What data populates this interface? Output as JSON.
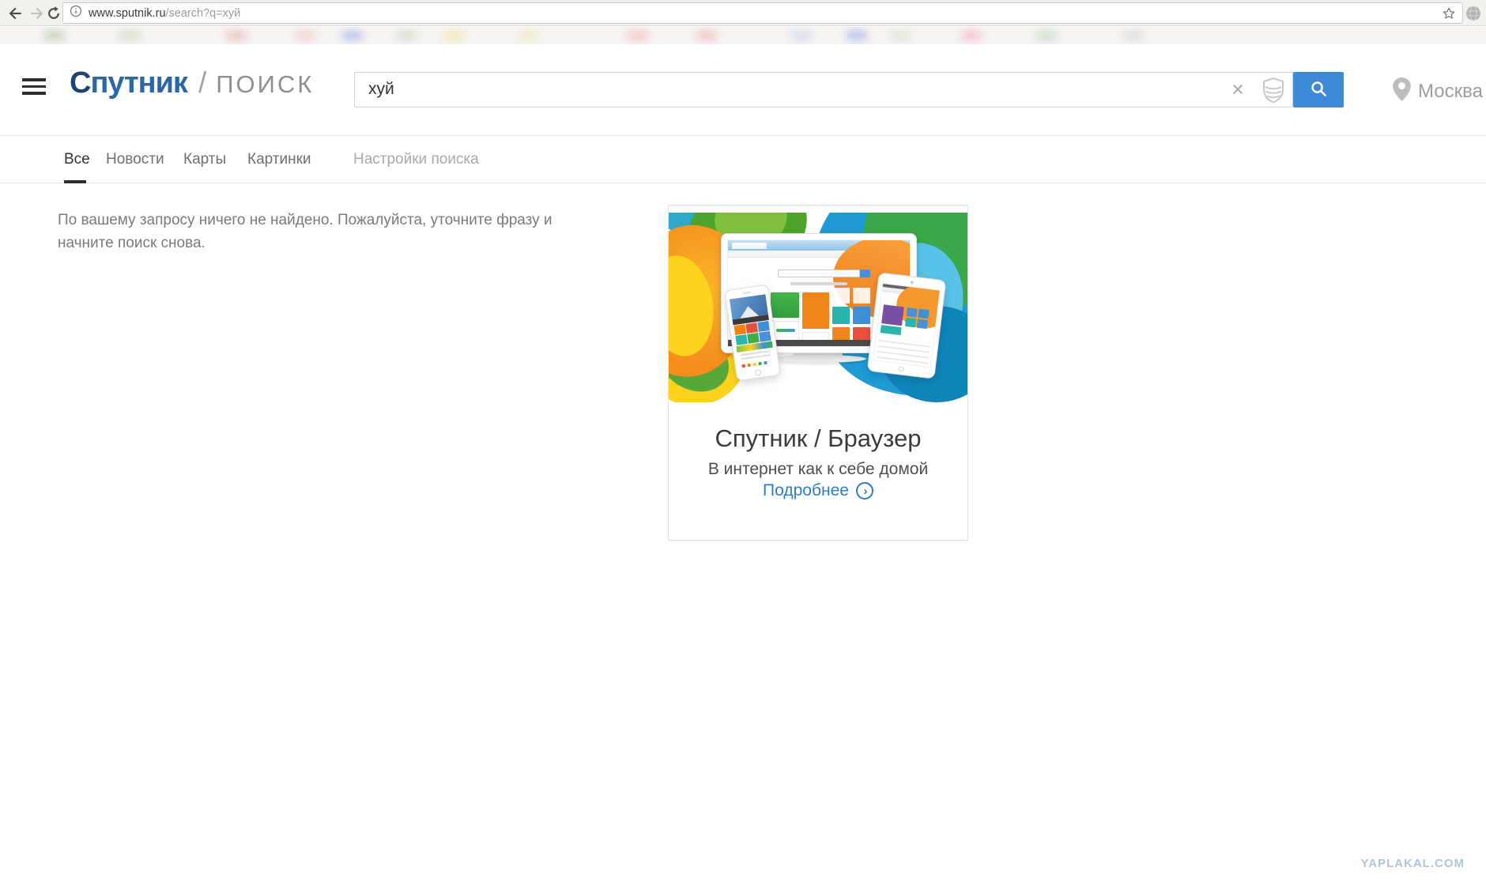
{
  "browser": {
    "url": {
      "host": "www.sputnik.ru",
      "path": "/search?q=хуй"
    }
  },
  "header": {
    "logo": {
      "brand_initial": "С",
      "brand_rest": "путник",
      "divider": "/",
      "product": "ПОИСК"
    },
    "search": {
      "value": "хуй"
    },
    "location": {
      "label": "Москва"
    }
  },
  "tabs": {
    "items": [
      {
        "label": "Все",
        "active": true
      },
      {
        "label": "Новости",
        "active": false
      },
      {
        "label": "Карты",
        "active": false
      },
      {
        "label": "Картинки",
        "active": false
      },
      {
        "label": "Настройки поиска",
        "active": false,
        "muted": true
      }
    ]
  },
  "results": {
    "empty_message": "По вашему запросу ничего не найдено. Пожалуйста, уточните фразу и начните поиск снова."
  },
  "promo": {
    "title": "Спутник / Браузер",
    "subtitle": "В интернет как к себе домой",
    "link_label": "Подробнее"
  },
  "watermark": {
    "text": "YAPLAKAL.COM"
  },
  "icons": {
    "clear_glyph": "×",
    "chevron_glyph": "›"
  },
  "colors": {
    "accent_blue": "#3d89d6",
    "logo_blue": "#2a67a4",
    "logo_navy": "#1d4472",
    "link_blue": "#2f7dc1",
    "tab_active_underline": "#2f2f2f",
    "watermark_blue": "#a9c3db"
  }
}
